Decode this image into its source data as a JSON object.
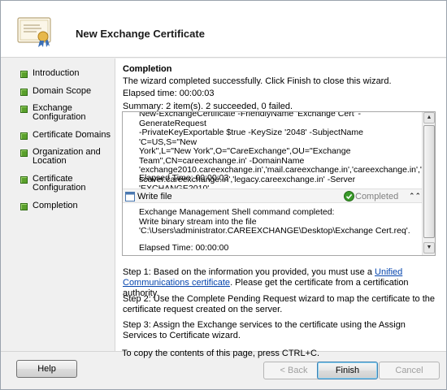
{
  "window": {
    "title": "New Exchange Certificate"
  },
  "sidebar": {
    "steps": [
      {
        "label": "Introduction"
      },
      {
        "label": "Domain Scope"
      },
      {
        "label": "Exchange Configuration",
        "line1": "Exchange",
        "line2": "Configuration"
      },
      {
        "label": "Certificate Domains"
      },
      {
        "label": "Organization and Location",
        "line1": "Organization and",
        "line2": "Location"
      },
      {
        "label": "Certificate Configuration",
        "line1": "Certificate",
        "line2": "Configuration"
      },
      {
        "label": "Completion"
      }
    ],
    "status_color": "#5aa02c"
  },
  "main": {
    "title": "Completion",
    "completed_message": "The wizard completed successfully. Click Finish to close this wizard.",
    "elapsed": "Elapsed time: 00:00:03",
    "summary": "Summary: 2 item(s). 2 succeeded, 0 failed.",
    "results": {
      "first_task_lines": [
        "New-ExchangeCertificate -FriendlyName 'Exchange Cert' -GenerateRequest",
        "-PrivateKeyExportable $true -KeySize '2048' -SubjectName 'C=US,S=\"New",
        "York\",L=\"New York\",O=\"CareExchange\",OU=\"Exchange",
        "Team\",CN=careexchange.in' -DomainName",
        "'exchange2010.careexchange.in','mail.careexchange.in','careexchange.in','autodi",
        "scover.careexchange.in','legacy.careexchange.in' -Server 'EXCHANGE2010'"
      ],
      "first_task_elapsed": "Elapsed Time: 00:00:03",
      "second_task": {
        "title": "Write file",
        "status": "Completed",
        "lines": [
          "Exchange Management Shell command completed:",
          "Write binary stream into the file",
          "'C:\\Users\\administrator.CAREEXCHANGE\\Desktop\\Exchange Cert.req'."
        ],
        "elapsed": "Elapsed Time: 00:00:00"
      }
    },
    "step1_prefix": "Step 1: Based on the information you provided, you must use a ",
    "step1_link": "Unified Communications certificate",
    "step1_suffix": ". Please get the certificate from a certification authority.",
    "step2": "Step 2: Use the Complete Pending Request wizard to map the certificate to the certificate request created on the server.",
    "step3": "Step 3: Assign the Exchange services to the certificate using the Assign Services to Certificate wizard.",
    "copy_hint": "To copy the contents of this page, press CTRL+C."
  },
  "footer": {
    "help": "Help",
    "back": "< Back",
    "finish": "Finish",
    "cancel": "Cancel"
  },
  "colors": {
    "completed_icon": "#3a9a2a",
    "link": "#0645ad"
  }
}
